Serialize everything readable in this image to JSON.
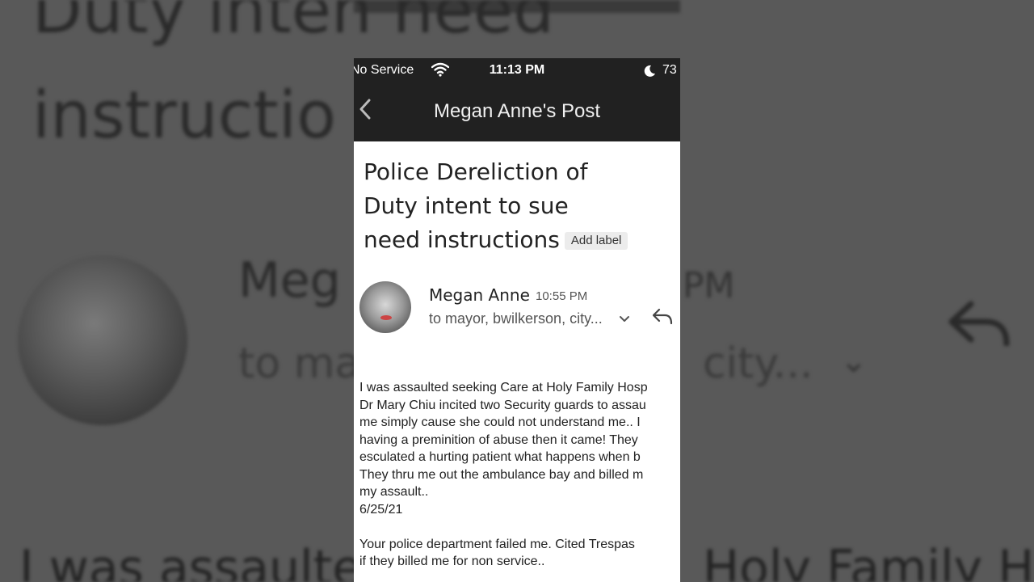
{
  "status_bar": {
    "carrier": "No Service",
    "time": "11:13 PM",
    "battery": "73"
  },
  "nav": {
    "title": "Megan Anne's Post"
  },
  "email": {
    "subject": "Police Dereliction of Duty intent to sue need instructions",
    "label_button": "Add label",
    "sender": "Megan Anne",
    "time": "10:55 PM",
    "recipients": "to mayor, bwilkerson, city...",
    "body_lines": [
      "I was assaulted seeking Care at Holy Family Hosp",
      "Dr Mary Chiu incited two Security guards to assau",
      "me simply cause she could not understand me.. I",
      "having a preminition of abuse then it came! They",
      "esculated a hurting patient what happens when b",
      "They thru me out the ambulance bay and billed m",
      "my assault..",
      "6/25/21"
    ],
    "body_lines_2": [
      "Your police department failed me. Cited Trespas",
      "if they billed me for non service.."
    ]
  },
  "background": {
    "title_top": "Duty inten          need",
    "title_mid": "instructio",
    "name": "Meg",
    "time": "PM",
    "to_left": "to ma",
    "to_right": "city...",
    "body_left": "I was assaulted",
    "body_right": "Holy Family Hosp"
  },
  "icons": {
    "back": "chevron-left-icon",
    "wifi": "wifi-icon",
    "moon": "moon-icon",
    "reply": "reply-icon",
    "expand": "chevron-down-icon"
  }
}
